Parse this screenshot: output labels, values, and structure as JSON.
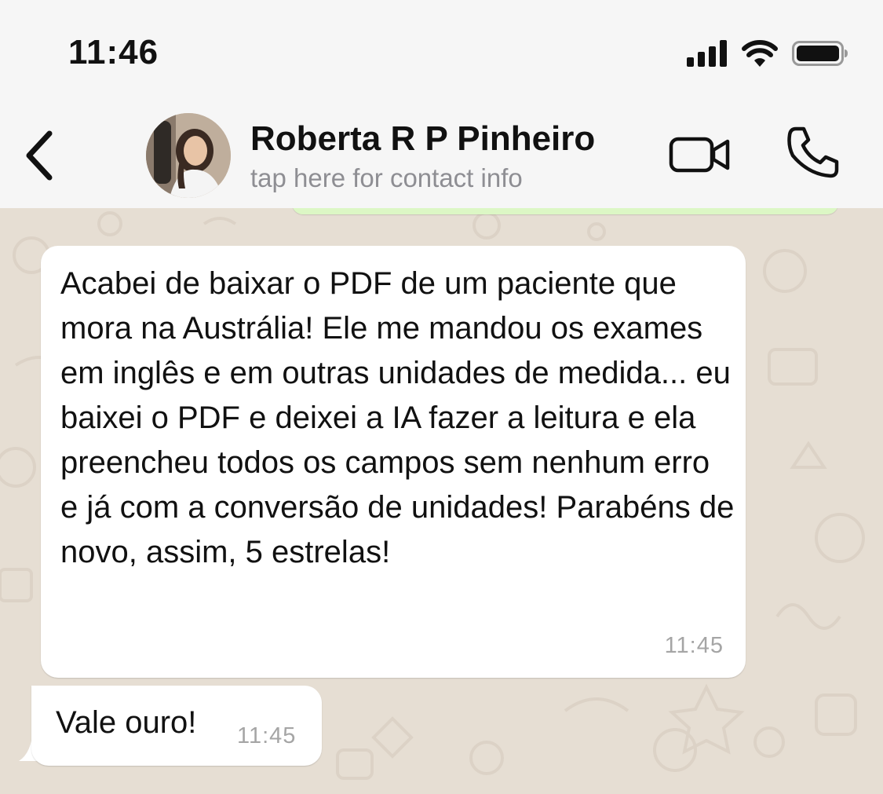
{
  "status_bar": {
    "time": "11:46",
    "icons": [
      "cellular-signal-icon",
      "wifi-icon",
      "battery-icon"
    ]
  },
  "header": {
    "contact_name": "Roberta R P Pinheiro",
    "contact_subtitle": "tap here for contact info",
    "back_icon": "chevron-left-icon",
    "video_icon": "video-camera-icon",
    "call_icon": "phone-icon"
  },
  "messages": [
    {
      "text": "Acabei de baixar o PDF de um paciente que mora na Austrália! Ele me mandou os exames em inglês e em outras unidades de medida... eu baixei o PDF e deixei a IA fazer a leitura e ela preencheu todos os campos sem nenhum erro e já com a conversão de unidades! Parabéns de novo, assim, 5 estrelas!",
      "time": "11:45",
      "direction": "incoming"
    },
    {
      "text": "Vale ouro!",
      "time": "11:45",
      "direction": "incoming"
    }
  ],
  "colors": {
    "header_bg": "#f6f6f6",
    "chat_bg": "#e6ded3",
    "incoming_bubble": "#ffffff",
    "outgoing_bubble": "#dcf7c5",
    "subtitle_text": "#8e8e93",
    "timestamp_text": "#a5a5a5"
  }
}
